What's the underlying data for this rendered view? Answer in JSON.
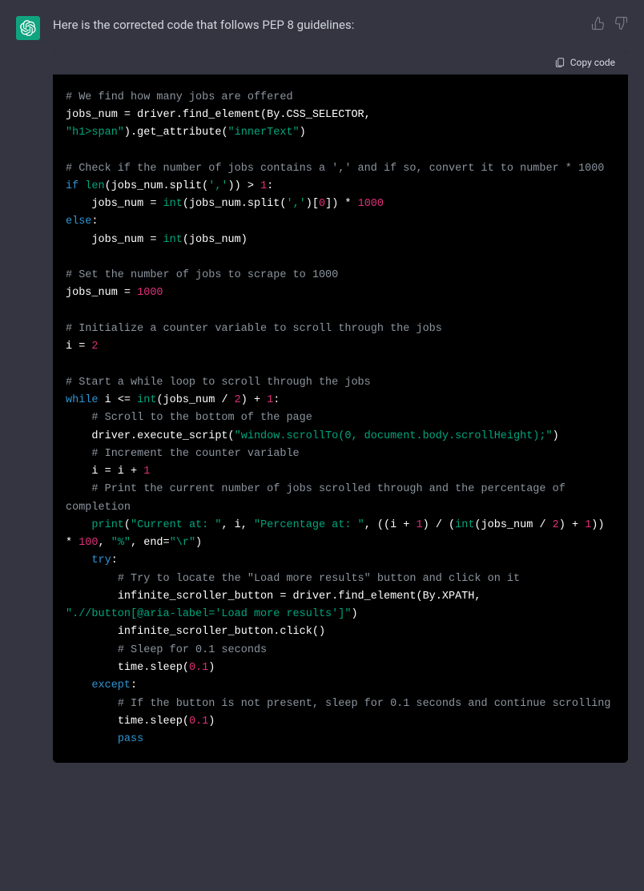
{
  "message": {
    "intro": "Here is the corrected code that follows PEP 8 guidelines:"
  },
  "codebox": {
    "copy_label": "Copy code"
  },
  "code": {
    "c1": "# We find how many jobs are offered",
    "l2a": "jobs_num = driver.find_element(By.CSS_SELECTOR,",
    "l3s": "\"h1>span\"",
    "l3b": ").get_attribute(",
    "l3s2": "\"innerText\"",
    "l3c": ")",
    "c2": "# Check if the number of jobs contains a ',' and if so, convert it to number * 1000",
    "l6a": "if",
    "l6b": " len",
    "l6c": "(jobs_num.split(",
    "l6s": "','",
    "l6d": ")) > ",
    "l6n": "1",
    "l6e": ":",
    "l7a": "    jobs_num = ",
    "l7b": "int",
    "l7c": "(jobs_num.split(",
    "l7s": "','",
    "l7d": ")[",
    "l7n1": "0",
    "l7e": "]) * ",
    "l7n2": "1000",
    "l8a": "else",
    "l8b": ":",
    "l9a": "    jobs_num = ",
    "l9b": "int",
    "l9c": "(jobs_num)",
    "c3": "# Set the number of jobs to scrape to 1000",
    "l12a": "jobs_num = ",
    "l12n": "1000",
    "c4": "# Initialize a counter variable to scroll through the jobs",
    "l15a": "i = ",
    "l15n": "2",
    "c5": "# Start a while loop to scroll through the jobs",
    "l18a": "while",
    "l18b": " i <= ",
    "l18c": "int",
    "l18d": "(jobs_num / ",
    "l18n1": "2",
    "l18e": ") + ",
    "l18n2": "1",
    "l18f": ":",
    "c6": "    # Scroll to the bottom of the page",
    "l20a": "    driver.execute_script(",
    "l20s": "\"window.scrollTo(0, document.body.scrollHeight);\"",
    "l20b": ")",
    "c7": "    # Increment the counter variable",
    "l22a": "    i = i + ",
    "l22n": "1",
    "c8": "    # Print the current number of jobs scrolled through and the percentage of completion",
    "l24a": "    print",
    "l24b": "(",
    "l24s1": "\"Current at: \"",
    "l24c": ", i, ",
    "l24s2": "\"Percentage at: \"",
    "l24d": ", ((i + ",
    "l24n1": "1",
    "l24e": ") / (",
    "l24f": "int",
    "l24g": "(jobs_num / ",
    "l24n2": "2",
    "l24h": ") + ",
    "l24n3": "1",
    "l24i": ")) * ",
    "l24n4": "100",
    "l24j": ", ",
    "l24s3": "\"%\"",
    "l24k": ", end=",
    "l24s4": "\"\\r\"",
    "l24l": ")",
    "l25a": "    try",
    "l25b": ":",
    "c9": "        # Try to locate the \"Load more results\" button and click on it",
    "l27a": "        infinite_scroller_button = driver.find_element(By.XPATH,",
    "l28s": "\".//button[@aria-label='Load more results']\"",
    "l28b": ")",
    "l29a": "        infinite_scroller_button.click()",
    "c10": "        # Sleep for 0.1 seconds",
    "l31a": "        time.sleep(",
    "l31n": "0.1",
    "l31b": ")",
    "l32a": "    except",
    "l32b": ":",
    "c11": "        # If the button is not present, sleep for 0.1 seconds and continue scrolling",
    "l34a": "        time.sleep(",
    "l34n": "0.1",
    "l34b": ")",
    "l35a": "        pass"
  }
}
